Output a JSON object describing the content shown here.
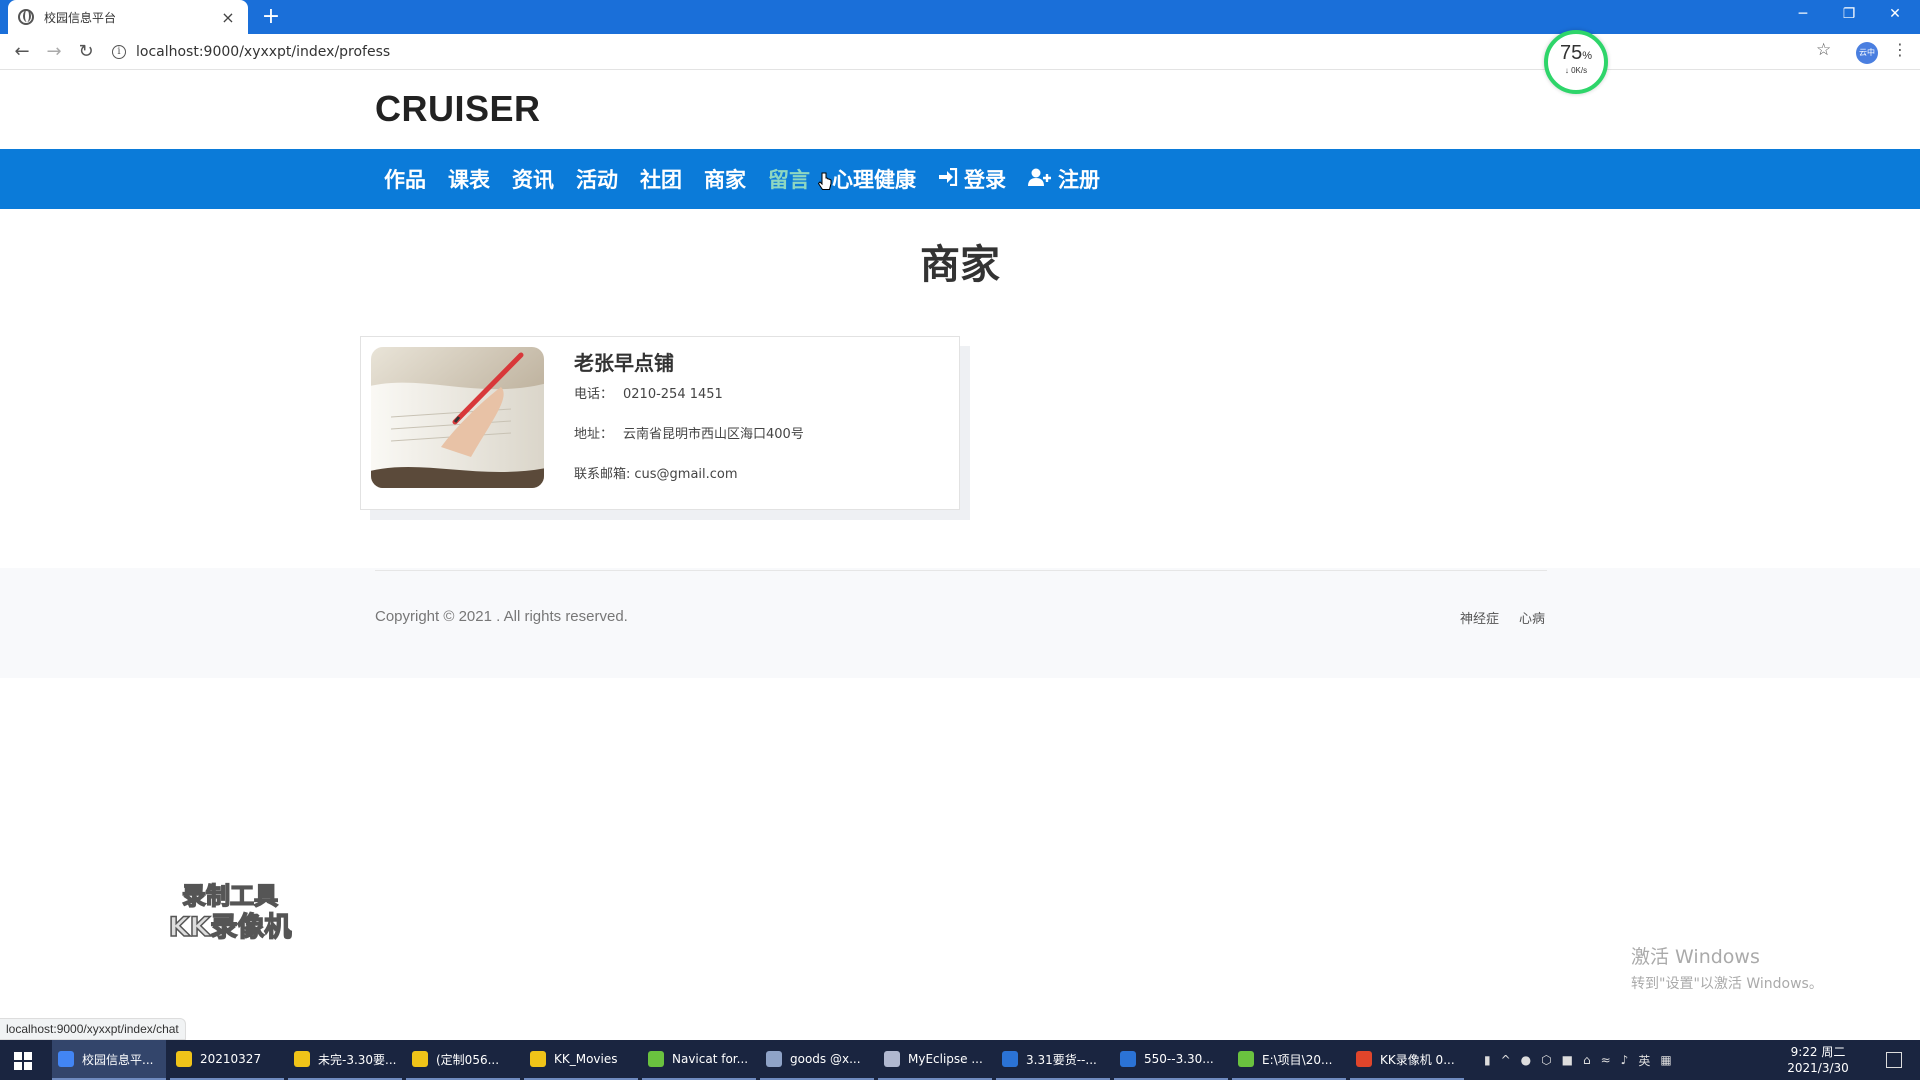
{
  "browser": {
    "tab_title": "校园信息平台",
    "tab_close": "×",
    "new_tab": "+",
    "url": "localhost:9000/xyxxpt/index/profess",
    "profile_text": "云中",
    "status_url": "localhost:9000/xyxxpt/index/chat",
    "window_controls": [
      "─",
      "❐",
      "✕"
    ]
  },
  "speed_widget": {
    "percent": "75",
    "percent_sign": "%",
    "rate": "↓ 0K/s"
  },
  "site": {
    "logo": "CRUISER",
    "nav": [
      {
        "label": "作品"
      },
      {
        "label": "课表"
      },
      {
        "label": "资讯"
      },
      {
        "label": "活动"
      },
      {
        "label": "社团"
      },
      {
        "label": "商家"
      },
      {
        "label": "留言"
      },
      {
        "label": "心理健康"
      },
      {
        "label": "登录",
        "icon": "sign-in-icon"
      },
      {
        "label": "注册",
        "icon": "user-plus-icon"
      }
    ],
    "heading": "商家"
  },
  "shop": {
    "name": "老张早点铺",
    "phone_label": "电话：",
    "phone": "0210-254 1451",
    "address_label": "地址：",
    "address": "云南省昆明市西山区海口400号",
    "email_label": "联系邮箱:",
    "email": "cus@gmail.com"
  },
  "footer": {
    "copyright": "Copyright © 2021 . All rights reserved.",
    "links": [
      "神经症",
      "心病"
    ]
  },
  "overlays": {
    "watermark_line1": "录制工具",
    "watermark_line2": "KK录像机",
    "activate_title": "激活 Windows",
    "activate_sub": "转到\"设置\"以激活 Windows。"
  },
  "taskbar": {
    "items": [
      {
        "label": "校园信息平...",
        "color": "#4285f4"
      },
      {
        "label": "20210327",
        "color": "#f0c419"
      },
      {
        "label": "未完-3.30要...",
        "color": "#f0c419"
      },
      {
        "label": "(定制056...",
        "color": "#f0c419"
      },
      {
        "label": "KK_Movies",
        "color": "#f0c419"
      },
      {
        "label": "Navicat for...",
        "color": "#6ac23f"
      },
      {
        "label": "goods @x...",
        "color": "#8fa3c7"
      },
      {
        "label": "MyEclipse ...",
        "color": "#b0b8d0"
      },
      {
        "label": "3.31要货--...",
        "color": "#2b73d6"
      },
      {
        "label": "550--3.30...",
        "color": "#2b73d6"
      },
      {
        "label": "E:\\项目\\20...",
        "color": "#6ac23f"
      },
      {
        "label": "KK录像机 0...",
        "color": "#e0452b"
      }
    ],
    "tray_lang": "英",
    "time": "9:22 周二",
    "date": "2021/3/30"
  }
}
